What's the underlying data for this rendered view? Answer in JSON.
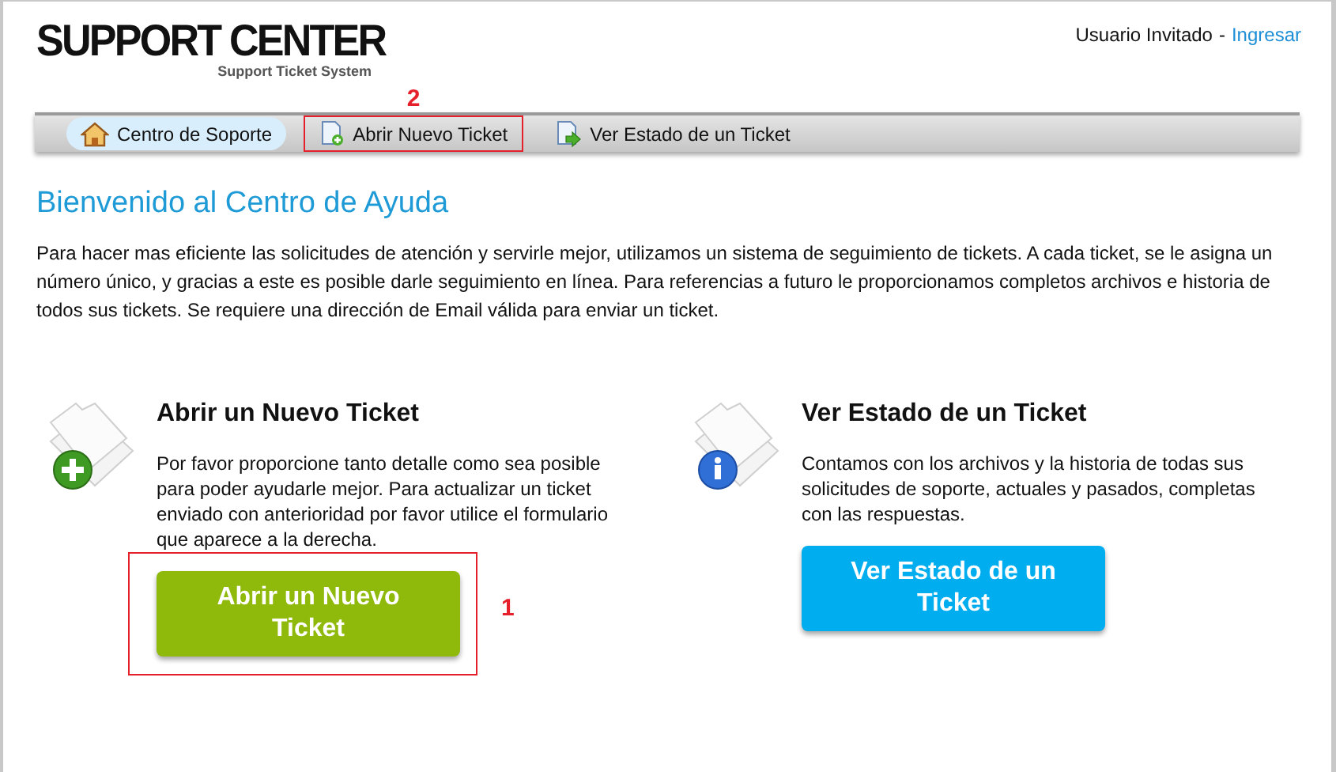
{
  "logo": {
    "title": "SUPPORT CENTER",
    "subtitle": "Support Ticket System"
  },
  "user": {
    "name": "Usuario Invitado",
    "separator": "-",
    "login_link": "Ingresar"
  },
  "nav": [
    {
      "label": "Centro de Soporte",
      "kind": "home",
      "selected": true
    },
    {
      "label": "Abrir Nuevo Ticket",
      "kind": "new",
      "selected": false,
      "callout": "2"
    },
    {
      "label": "Ver Estado de un Ticket",
      "kind": "status",
      "selected": false
    }
  ],
  "welcome": {
    "heading": "Bienvenido al Centro de Ayuda",
    "text": "Para hacer mas eficiente las solicitudes de atención y servirle mejor, utilizamos un sistema de seguimiento de tickets. A cada ticket, se le asigna un número único, y gracias a este es posible darle seguimiento en línea. Para referencias a futuro le proporcionamos completos archivos e historia de todos sus tickets. Se requiere una dirección de Email válida para enviar un ticket."
  },
  "panels": [
    {
      "kind": "new",
      "title": "Abrir un Nuevo Ticket",
      "text": "Por favor proporcione tanto detalle como sea posible para poder ayudarle mejor. Para actualizar un ticket enviado con anterioridad por favor utilice el formulario que aparece a la derecha.",
      "button": "Abrir un Nuevo Ticket",
      "callout": "1"
    },
    {
      "kind": "status",
      "title": "Ver Estado de un Ticket",
      "text": "Contamos con los archivos y la historia de todas sus solicitudes de soporte, actuales y pasados, completas con las respuestas.",
      "button": "Ver Estado de un Ticket"
    }
  ]
}
